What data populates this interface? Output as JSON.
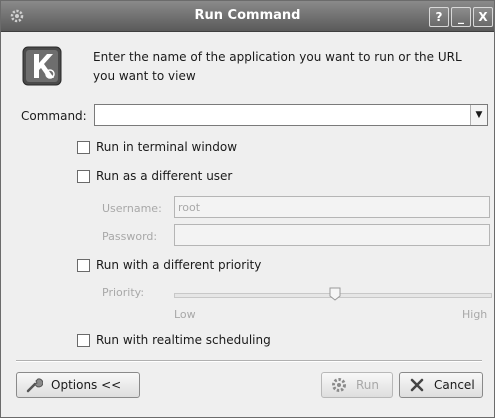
{
  "window": {
    "title": "Run Command",
    "help_button": "?",
    "minimize_button": "_",
    "close_button": "X"
  },
  "description": "Enter the name of the application you want to run or the URL you want to view",
  "command": {
    "label": "Command:",
    "value": ""
  },
  "options": {
    "terminal": "Run in terminal window",
    "different_user": "Run as a different user",
    "username_label": "Username:",
    "username_value": "root",
    "password_label": "Password:",
    "password_value": "",
    "priority_check": "Run with a different priority",
    "priority_label": "Priority:",
    "priority_low": "Low",
    "priority_high": "High",
    "priority_level": 0.5,
    "realtime": "Run with realtime scheduling"
  },
  "buttons": {
    "options": "Options <<",
    "run": "Run",
    "cancel": "Cancel"
  },
  "icons": {
    "app": "gear-icon",
    "logo": "kde-logo-icon",
    "options": "wrench-icon",
    "run": "gear-icon",
    "cancel": "cancel-x-icon"
  }
}
